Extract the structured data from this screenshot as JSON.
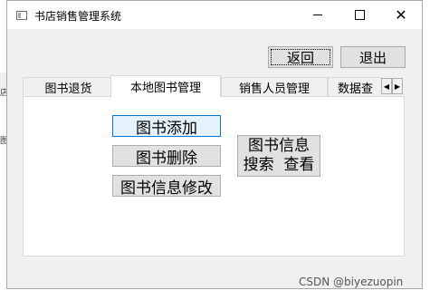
{
  "background": {
    "left_chars": [
      "店",
      "图"
    ]
  },
  "window": {
    "title": "书店销售管理系统",
    "controls": {
      "minimize": "",
      "maximize": "",
      "close": "✕"
    }
  },
  "toolbar": {
    "back_label": "返回",
    "exit_label": "退出"
  },
  "tabs": {
    "items": [
      {
        "label": "图书退货",
        "active": false
      },
      {
        "label": "本地图书管理",
        "active": true
      },
      {
        "label": "销售人员管理",
        "active": false
      },
      {
        "label": "数据查",
        "active": false
      }
    ],
    "scroll_left": "◀",
    "scroll_right": "▶"
  },
  "panel": {
    "add_label": "图书添加",
    "delete_label": "图书删除",
    "modify_label": "图书信息修改",
    "search_label": "图书信息\n搜索  查看"
  },
  "watermark": "CSDN @biyezuopin"
}
